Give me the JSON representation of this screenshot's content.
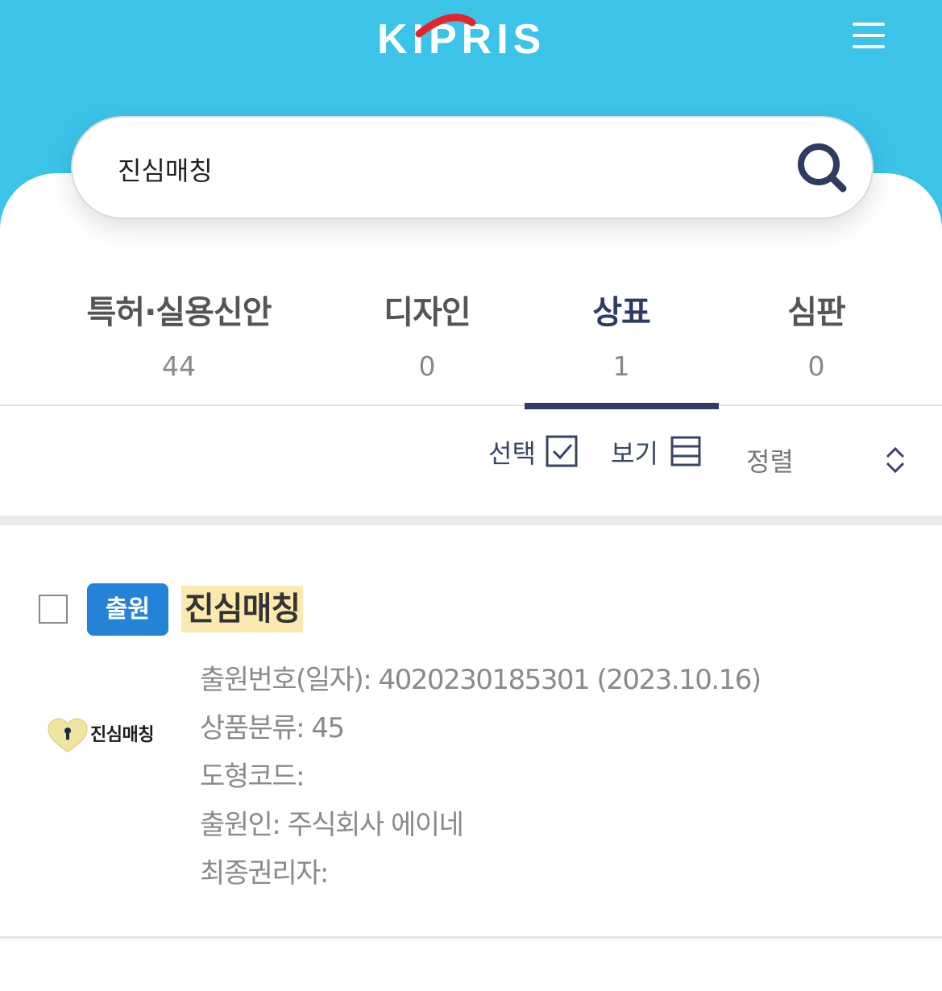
{
  "header": {
    "logo_text": "KIPRIS",
    "menu_icon": "hamburger-menu-icon"
  },
  "search": {
    "value": "진심매칭",
    "icon": "search-icon"
  },
  "tabs": [
    {
      "label": "특허·실용신안",
      "count": "44"
    },
    {
      "label": "디자인",
      "count": "0"
    },
    {
      "label": "상표",
      "count": "1"
    },
    {
      "label": "심판",
      "count": "0"
    }
  ],
  "toolbar": {
    "select_label": "선택",
    "view_label": "보기",
    "sort_label": "정렬"
  },
  "results": [
    {
      "status": "출원",
      "title": "진심매칭",
      "trademark_image_text": "진심매칭",
      "details": [
        "출원번호(일자): 4020230185301 (2023.10.16)",
        "상품분류: 45",
        "도형코드:",
        "출원인: 주식회사 에이네",
        "최종권리자:"
      ]
    }
  ],
  "colors": {
    "header_bg": "#3cc3e8",
    "active_tab": "#2f3b60",
    "badge_bg": "#2483d6",
    "highlight": "#fce9b0"
  }
}
